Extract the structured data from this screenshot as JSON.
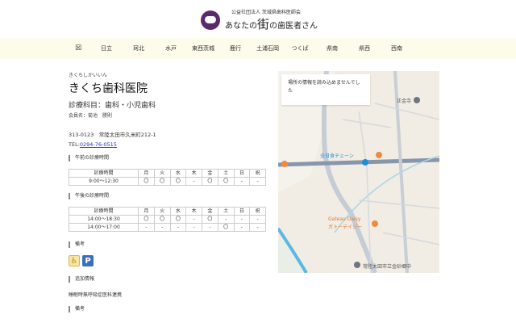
{
  "header": {
    "org": "公益社団法人 茨城県歯科医師会",
    "title_pre": "あなたの",
    "title_big": "街",
    "title_post": "の歯医者さん"
  },
  "nav": {
    "items": [
      "☒",
      "日立",
      "珂北",
      "水戸",
      "東西茨城",
      "鹿行",
      "土浦石岡",
      "つくば",
      "県南",
      "県西",
      "西南"
    ]
  },
  "clinic": {
    "kana": "きくちしかいいん",
    "name": "きくち歯科医院",
    "subjects": "診療科目：歯科・小児歯科",
    "member": "会員名：菊池　勝則",
    "address": "313-0123　常陸太田市久米町212-1",
    "tel_label": "TEL:",
    "tel": "0294-76-0515"
  },
  "morning": {
    "title": "午前の診療時間",
    "header": [
      "診療時間",
      "月",
      "火",
      "水",
      "木",
      "金",
      "土",
      "日",
      "祝"
    ],
    "rows": [
      [
        "9:00～12:30",
        "〇",
        "〇",
        "〇",
        "-",
        "〇",
        "〇",
        "-",
        "-"
      ]
    ]
  },
  "afternoon": {
    "title": "午後の診療時間",
    "header": [
      "診療時間",
      "月",
      "火",
      "水",
      "木",
      "金",
      "土",
      "日",
      "祝"
    ],
    "rows": [
      [
        "14:00～18:30",
        "〇",
        "〇",
        "〇",
        "-",
        "〇",
        "-",
        "-",
        "-"
      ],
      [
        "14:00～17:00",
        "-",
        "-",
        "-",
        "-",
        "-",
        "〇",
        "-",
        "-"
      ]
    ]
  },
  "notes": {
    "title": "備考",
    "icons": [
      "wheelchair-icon",
      "parking-icon"
    ],
    "wheelchair": "♿",
    "parking": "P"
  },
  "additional": {
    "title": "追加情報",
    "text": "睡眠時無呼吸症医科連携"
  },
  "notes2": {
    "title": "備考"
  },
  "map": {
    "message": "場所の情報を読み込めませんでした",
    "labels": {
      "temple": "正金寺",
      "shop1": "Gateau Daisy",
      "shop2": "ガトーデイジー",
      "school": "常陸太田市立金砂郷中",
      "store": "全日食チェーン"
    }
  }
}
